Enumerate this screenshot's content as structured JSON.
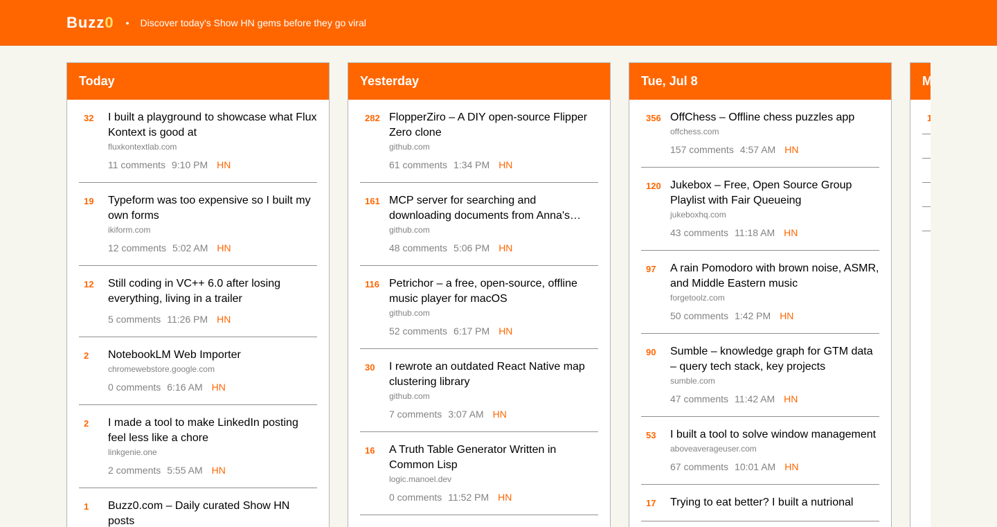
{
  "header": {
    "logo_main": "Buzz",
    "logo_zero": "0",
    "separator": "•",
    "tagline": "Discover today's Show HN gems before they go viral"
  },
  "columns": [
    {
      "title": "Today",
      "items": [
        {
          "score": "32",
          "title": "I built a playground to showcase what Flux Kontext is good at",
          "domain": "fluxkontextlab.com",
          "comments": "11 comments",
          "time": "9:10 PM",
          "hn": "HN"
        },
        {
          "score": "19",
          "title": "Typeform was too expensive so I built my own forms",
          "domain": "ikiform.com",
          "comments": "12 comments",
          "time": "5:02 AM",
          "hn": "HN"
        },
        {
          "score": "12",
          "title": "Still coding in VC++ 6.0 after losing everything, living in a trailer",
          "domain": "",
          "comments": "5 comments",
          "time": "11:26 PM",
          "hn": "HN"
        },
        {
          "score": "2",
          "title": "NotebookLM Web Importer",
          "domain": "chromewebstore.google.com",
          "comments": "0 comments",
          "time": "6:16 AM",
          "hn": "HN"
        },
        {
          "score": "2",
          "title": "I made a tool to make LinkedIn posting feel less like a chore",
          "domain": "linkgenie.one",
          "comments": "2 comments",
          "time": "5:55 AM",
          "hn": "HN"
        },
        {
          "score": "1",
          "title": "Buzz0.com – Daily curated Show HN posts",
          "domain": "",
          "comments": "",
          "time": "",
          "hn": ""
        }
      ]
    },
    {
      "title": "Yesterday",
      "items": [
        {
          "score": "282",
          "title": "FlopperZiro – A DIY open-source Flipper Zero clone",
          "domain": "github.com",
          "comments": "61 comments",
          "time": "1:34 PM",
          "hn": "HN"
        },
        {
          "score": "161",
          "title": "MCP server for searching and downloading documents from Anna's…",
          "domain": "github.com",
          "comments": "48 comments",
          "time": "5:06 PM",
          "hn": "HN"
        },
        {
          "score": "116",
          "title": "Petrichor – a free, open-source, offline music player for macOS",
          "domain": "github.com",
          "comments": "52 comments",
          "time": "6:17 PM",
          "hn": "HN"
        },
        {
          "score": "30",
          "title": "I rewrote an outdated React Native map clustering library",
          "domain": "github.com",
          "comments": "7 comments",
          "time": "3:07 AM",
          "hn": "HN"
        },
        {
          "score": "16",
          "title": "A Truth Table Generator Written in Common Lisp",
          "domain": "logic.manoel.dev",
          "comments": "0 comments",
          "time": "11:52 PM",
          "hn": "HN"
        }
      ]
    },
    {
      "title": "Tue, Jul 8",
      "items": [
        {
          "score": "356",
          "title": "OffChess – Offline chess puzzles app",
          "domain": "offchess.com",
          "comments": "157 comments",
          "time": "4:57 AM",
          "hn": "HN"
        },
        {
          "score": "120",
          "title": "Jukebox – Free, Open Source Group Playlist with Fair Queueing",
          "domain": "jukeboxhq.com",
          "comments": "43 comments",
          "time": "11:18 AM",
          "hn": "HN"
        },
        {
          "score": "97",
          "title": "A rain Pomodoro with brown noise, ASMR, and Middle Eastern music",
          "domain": "forgetoolz.com",
          "comments": "50 comments",
          "time": "1:42 PM",
          "hn": "HN"
        },
        {
          "score": "90",
          "title": "Sumble – knowledge graph for GTM data – query tech stack, key projects",
          "domain": "sumble.com",
          "comments": "47 comments",
          "time": "11:42 AM",
          "hn": "HN"
        },
        {
          "score": "53",
          "title": "I built a tool to solve window management",
          "domain": "aboveaverageuser.com",
          "comments": "67 comments",
          "time": "10:01 AM",
          "hn": "HN"
        },
        {
          "score": "17",
          "title": "Trying to eat better? I built a nutrional",
          "domain": "",
          "comments": "",
          "time": "",
          "hn": ""
        }
      ]
    },
    {
      "title": "M",
      "items": [
        {
          "score": "1",
          "title": "",
          "domain": "",
          "comments": "",
          "time": "",
          "hn": ""
        },
        {
          "score": "",
          "title": "",
          "domain": "",
          "comments": "",
          "time": "",
          "hn": ""
        },
        {
          "score": "",
          "title": "",
          "domain": "",
          "comments": "",
          "time": "",
          "hn": ""
        },
        {
          "score": "",
          "title": "",
          "domain": "",
          "comments": "",
          "time": "",
          "hn": ""
        },
        {
          "score": "",
          "title": "",
          "domain": "",
          "comments": "",
          "time": "",
          "hn": ""
        }
      ]
    }
  ]
}
